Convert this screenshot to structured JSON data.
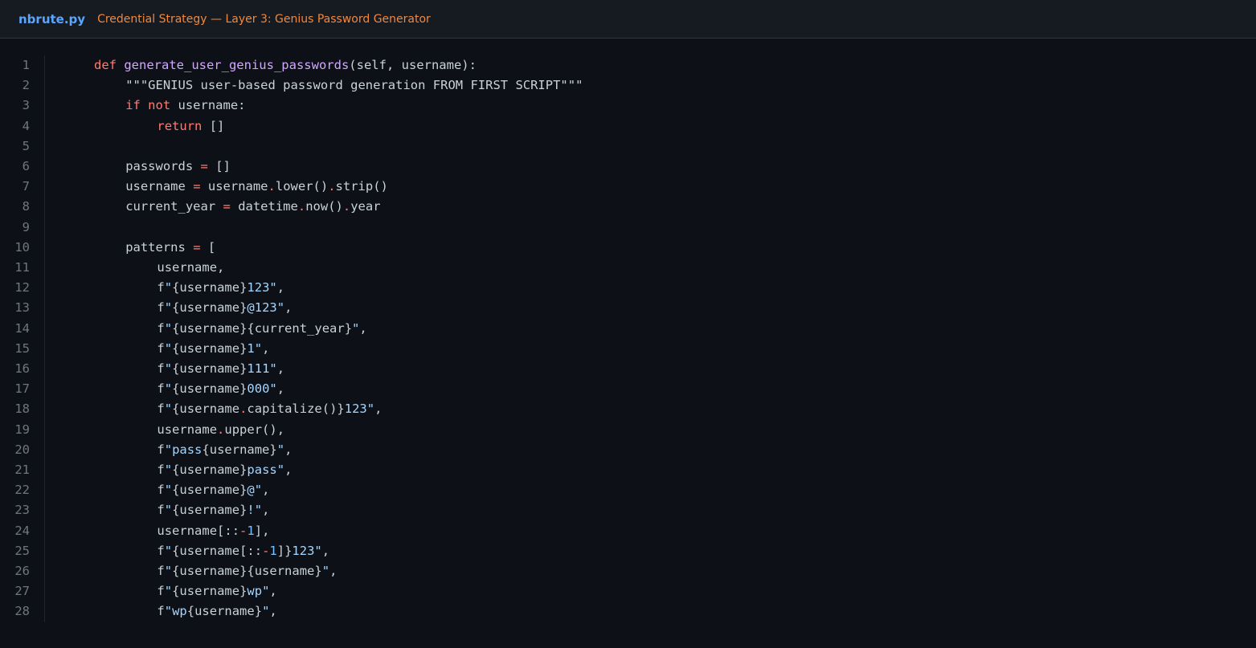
{
  "header": {
    "filename": "nbrute.py",
    "subtitle": "Credential Strategy — Layer 3: Genius Password Generator"
  },
  "colors": {
    "background": "#0d1117",
    "header_background": "#161b22",
    "filename": "#58a6ff",
    "subtitle": "#f0883e",
    "keyword": "#ff7b72",
    "function": "#d2a8ff",
    "string": "#a5d6ff",
    "number": "#79c0ff",
    "text": "#c9d1d9",
    "line_number": "#6e7681"
  },
  "lines": [
    {
      "n": "1",
      "indent": 0,
      "tokens": [
        [
          "kw",
          "def "
        ],
        [
          "fn",
          "generate_user_genius_passwords"
        ],
        [
          "txt",
          "(self, username):"
        ]
      ]
    },
    {
      "n": "2",
      "indent": 4,
      "tokens": [
        [
          "txt",
          "\"\"\"GENIUS user-based password generation FROM FIRST SCRIPT\"\"\""
        ]
      ]
    },
    {
      "n": "3",
      "indent": 4,
      "tokens": [
        [
          "kw",
          "if not "
        ],
        [
          "txt",
          "username:"
        ]
      ]
    },
    {
      "n": "4",
      "indent": 8,
      "tokens": [
        [
          "kw",
          "return "
        ],
        [
          "txt",
          "[]"
        ]
      ]
    },
    {
      "n": "5",
      "indent": 0,
      "tokens": []
    },
    {
      "n": "6",
      "indent": 4,
      "tokens": [
        [
          "txt",
          "passwords "
        ],
        [
          "op",
          "="
        ],
        [
          "txt",
          " []"
        ]
      ]
    },
    {
      "n": "7",
      "indent": 4,
      "tokens": [
        [
          "txt",
          "username "
        ],
        [
          "op",
          "="
        ],
        [
          "txt",
          " username"
        ],
        [
          "op",
          "."
        ],
        [
          "txt",
          "lower()"
        ],
        [
          "op",
          "."
        ],
        [
          "txt",
          "strip()"
        ]
      ]
    },
    {
      "n": "8",
      "indent": 4,
      "tokens": [
        [
          "txt",
          "current_year "
        ],
        [
          "op",
          "="
        ],
        [
          "txt",
          " datetime"
        ],
        [
          "op",
          "."
        ],
        [
          "txt",
          "now()"
        ],
        [
          "op",
          "."
        ],
        [
          "txt",
          "year"
        ]
      ]
    },
    {
      "n": "9",
      "indent": 0,
      "tokens": []
    },
    {
      "n": "10",
      "indent": 4,
      "tokens": [
        [
          "txt",
          "patterns "
        ],
        [
          "op",
          "="
        ],
        [
          "txt",
          " ["
        ]
      ]
    },
    {
      "n": "11",
      "indent": 8,
      "tokens": [
        [
          "txt",
          "username,"
        ]
      ]
    },
    {
      "n": "12",
      "indent": 8,
      "tokens": [
        [
          "txt",
          "f"
        ],
        [
          "str",
          "\""
        ],
        [
          "txt",
          "{username}"
        ],
        [
          "str",
          "123\""
        ],
        [
          "txt",
          ","
        ]
      ]
    },
    {
      "n": "13",
      "indent": 8,
      "tokens": [
        [
          "txt",
          "f"
        ],
        [
          "str",
          "\""
        ],
        [
          "txt",
          "{username}"
        ],
        [
          "str",
          "@123\""
        ],
        [
          "txt",
          ","
        ]
      ]
    },
    {
      "n": "14",
      "indent": 8,
      "tokens": [
        [
          "txt",
          "f"
        ],
        [
          "str",
          "\""
        ],
        [
          "txt",
          "{username}{current_year}"
        ],
        [
          "str",
          "\""
        ],
        [
          "txt",
          ","
        ]
      ]
    },
    {
      "n": "15",
      "indent": 8,
      "tokens": [
        [
          "txt",
          "f"
        ],
        [
          "str",
          "\""
        ],
        [
          "txt",
          "{username}"
        ],
        [
          "str",
          "1\""
        ],
        [
          "txt",
          ","
        ]
      ]
    },
    {
      "n": "16",
      "indent": 8,
      "tokens": [
        [
          "txt",
          "f"
        ],
        [
          "str",
          "\""
        ],
        [
          "txt",
          "{username}"
        ],
        [
          "str",
          "111\""
        ],
        [
          "txt",
          ","
        ]
      ]
    },
    {
      "n": "17",
      "indent": 8,
      "tokens": [
        [
          "txt",
          "f"
        ],
        [
          "str",
          "\""
        ],
        [
          "txt",
          "{username}"
        ],
        [
          "str",
          "000\""
        ],
        [
          "txt",
          ","
        ]
      ]
    },
    {
      "n": "18",
      "indent": 8,
      "tokens": [
        [
          "txt",
          "f"
        ],
        [
          "str",
          "\""
        ],
        [
          "txt",
          "{username"
        ],
        [
          "op",
          "."
        ],
        [
          "txt",
          "capitalize()}"
        ],
        [
          "str",
          "123\""
        ],
        [
          "txt",
          ","
        ]
      ]
    },
    {
      "n": "19",
      "indent": 8,
      "tokens": [
        [
          "txt",
          "username"
        ],
        [
          "op",
          "."
        ],
        [
          "txt",
          "upper(),"
        ]
      ]
    },
    {
      "n": "20",
      "indent": 8,
      "tokens": [
        [
          "txt",
          "f"
        ],
        [
          "str",
          "\"pass"
        ],
        [
          "txt",
          "{username}"
        ],
        [
          "str",
          "\""
        ],
        [
          "txt",
          ","
        ]
      ]
    },
    {
      "n": "21",
      "indent": 8,
      "tokens": [
        [
          "txt",
          "f"
        ],
        [
          "str",
          "\""
        ],
        [
          "txt",
          "{username}"
        ],
        [
          "str",
          "pass\""
        ],
        [
          "txt",
          ","
        ]
      ]
    },
    {
      "n": "22",
      "indent": 8,
      "tokens": [
        [
          "txt",
          "f"
        ],
        [
          "str",
          "\""
        ],
        [
          "txt",
          "{username}"
        ],
        [
          "str",
          "@\""
        ],
        [
          "txt",
          ","
        ]
      ]
    },
    {
      "n": "23",
      "indent": 8,
      "tokens": [
        [
          "txt",
          "f"
        ],
        [
          "str",
          "\""
        ],
        [
          "txt",
          "{username}"
        ],
        [
          "str",
          "!\""
        ],
        [
          "txt",
          ","
        ]
      ]
    },
    {
      "n": "24",
      "indent": 8,
      "tokens": [
        [
          "txt",
          "username[::"
        ],
        [
          "op",
          "-"
        ],
        [
          "num",
          "1"
        ],
        [
          "txt",
          "],"
        ]
      ]
    },
    {
      "n": "25",
      "indent": 8,
      "tokens": [
        [
          "txt",
          "f"
        ],
        [
          "str",
          "\""
        ],
        [
          "txt",
          "{username[::"
        ],
        [
          "op",
          "-"
        ],
        [
          "num",
          "1"
        ],
        [
          "txt",
          "]}"
        ],
        [
          "str",
          "123\""
        ],
        [
          "txt",
          ","
        ]
      ]
    },
    {
      "n": "26",
      "indent": 8,
      "tokens": [
        [
          "txt",
          "f"
        ],
        [
          "str",
          "\""
        ],
        [
          "txt",
          "{username}{username}"
        ],
        [
          "str",
          "\""
        ],
        [
          "txt",
          ","
        ]
      ]
    },
    {
      "n": "27",
      "indent": 8,
      "tokens": [
        [
          "txt",
          "f"
        ],
        [
          "str",
          "\""
        ],
        [
          "txt",
          "{username}"
        ],
        [
          "str",
          "wp\""
        ],
        [
          "txt",
          ","
        ]
      ]
    },
    {
      "n": "28",
      "indent": 8,
      "tokens": [
        [
          "txt",
          "f"
        ],
        [
          "str",
          "\"wp"
        ],
        [
          "txt",
          "{username}"
        ],
        [
          "str",
          "\""
        ],
        [
          "txt",
          ","
        ]
      ]
    }
  ]
}
